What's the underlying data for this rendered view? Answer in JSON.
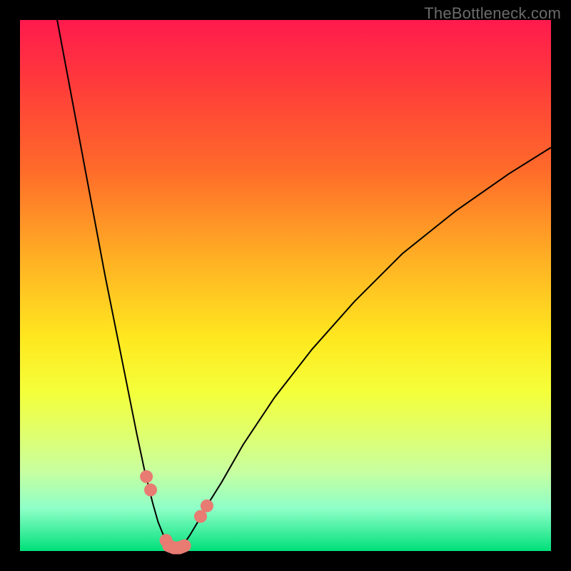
{
  "watermark": "TheBottleneck.com",
  "colors": {
    "background": "#000000",
    "gradient_top": "#ff1a4d",
    "gradient_bottom": "#00e07a",
    "curve": "#000000",
    "marker": "#e87b72"
  },
  "chart_data": {
    "type": "line",
    "title": "",
    "xlabel": "",
    "ylabel": "",
    "xlim": [
      0,
      100
    ],
    "ylim": [
      0,
      100
    ],
    "series": [
      {
        "name": "left_branch",
        "x": [
          7,
          10,
          13,
          16,
          19,
          22,
          23.5,
          25,
          26,
          27,
          27.8,
          28.6
        ],
        "y": [
          100,
          84,
          68,
          52,
          37,
          22,
          15,
          9,
          5.5,
          3,
          1.5,
          0.8
        ]
      },
      {
        "name": "right_branch",
        "x": [
          30.2,
          31,
          32,
          33.5,
          35.5,
          38,
          42,
          48,
          55,
          63,
          72,
          82,
          92,
          100
        ],
        "y": [
          0.8,
          1.5,
          3,
          5.5,
          9,
          13,
          20,
          29,
          38,
          47,
          56,
          64,
          71,
          76
        ]
      }
    ],
    "markers": [
      {
        "series": "left_branch",
        "x": 23.8,
        "y": 14.0
      },
      {
        "series": "left_branch",
        "x": 24.6,
        "y": 11.5
      },
      {
        "series": "left_branch",
        "x": 27.5,
        "y": 2.0
      },
      {
        "series": "right_branch",
        "x": 34.0,
        "y": 6.5
      },
      {
        "series": "right_branch",
        "x": 35.2,
        "y": 8.5
      }
    ],
    "valley_segment": {
      "x": [
        28.0,
        29.0,
        30.0,
        31.0
      ],
      "y": [
        1.0,
        0.6,
        0.6,
        1.0
      ]
    }
  }
}
